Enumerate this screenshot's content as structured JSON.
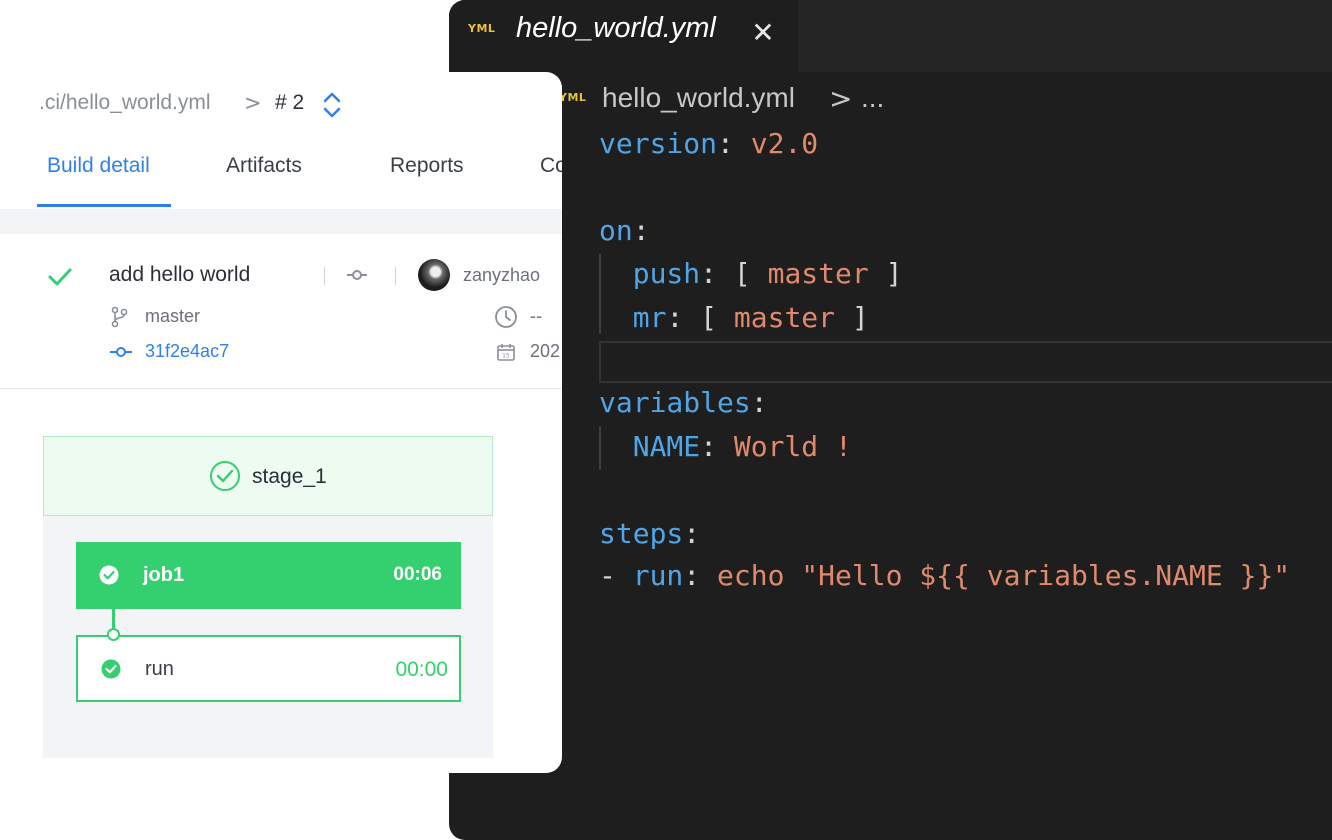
{
  "editor": {
    "tab": {
      "icon": "yml-file-icon",
      "icon_text": "YML",
      "title": "hello_world.yml",
      "close_icon": "close-icon"
    },
    "breadcrumb": {
      "file": "hello_world.yml",
      "separator": ">",
      "more": "..."
    },
    "code": {
      "version_key": "version",
      "version_value": "v2.0",
      "on_key": "on",
      "push_key": "push",
      "push_value": "master",
      "mr_key": "mr",
      "mr_value": "master",
      "variables_key": "variables",
      "name_key": "NAME",
      "name_value": "World !",
      "steps_key": "steps",
      "run_dash": "-",
      "run_key": "run",
      "run_value": "echo \"Hello ${{ variables.NAME }}\""
    },
    "colors": {
      "background": "#1e1e1e",
      "key": "#4fa5e6",
      "value": "#e0896b",
      "punctuation": "#d4d4d4"
    }
  },
  "ci": {
    "breadcrumb": {
      "file": ".ci/hello_world.yml",
      "separator": ">",
      "build_number": "# 2"
    },
    "tabs": [
      {
        "label": "Build detail",
        "active": true
      },
      {
        "label": "Artifacts",
        "active": false
      },
      {
        "label": "Reports",
        "active": false
      },
      {
        "label": "Co",
        "active": false
      }
    ],
    "commit": {
      "status_icon": "check-icon",
      "title": "add hello world",
      "author": "zanyzhao",
      "branch": "master",
      "sha": "31f2e4ac7",
      "duration": "--",
      "date": "202"
    },
    "stage": {
      "name": "stage_1",
      "status": "success",
      "job": {
        "name": "job1",
        "time": "00:06",
        "status": "success"
      },
      "steps": [
        {
          "name": "run",
          "time": "00:00",
          "status": "success"
        }
      ]
    },
    "colors": {
      "accent": "#2f80ed",
      "success": "#34d070",
      "stage_bg": "#edfbf1"
    }
  }
}
